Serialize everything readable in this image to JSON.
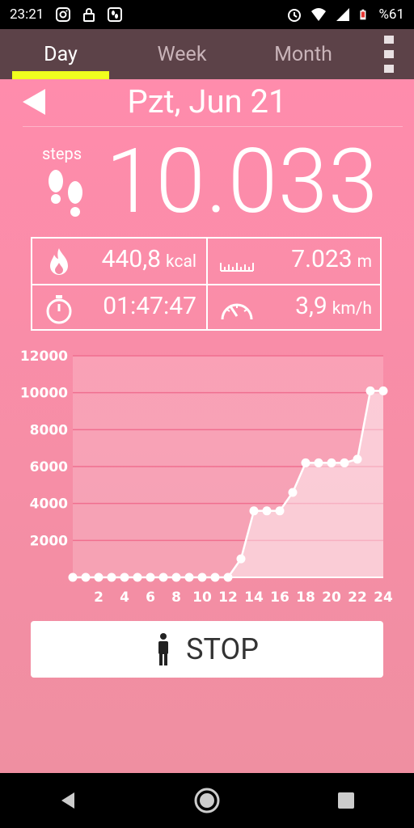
{
  "status_bar": {
    "time": "23:21",
    "battery": "%61"
  },
  "tabs": [
    {
      "label": "Day",
      "active": true
    },
    {
      "label": "Week",
      "active": false
    },
    {
      "label": "Month",
      "active": false
    }
  ],
  "date": "Pzt, Jun 21",
  "steps": {
    "label": "steps",
    "value": "10.033"
  },
  "stats": {
    "calories": {
      "value": "440,8",
      "unit": "kcal"
    },
    "distance": {
      "value": "7.023",
      "unit": "m"
    },
    "duration": {
      "value": "01:47:47",
      "unit": ""
    },
    "speed": {
      "value": "3,9",
      "unit": "km/h"
    }
  },
  "chart_data": {
    "type": "area",
    "x": [
      0,
      1,
      2,
      3,
      4,
      5,
      6,
      7,
      8,
      9,
      10,
      11,
      12,
      13,
      14,
      15,
      16,
      17,
      18,
      19,
      20,
      21,
      22,
      23,
      24
    ],
    "values": [
      0,
      0,
      0,
      0,
      0,
      0,
      0,
      0,
      0,
      0,
      0,
      0,
      0,
      1000,
      3600,
      3600,
      3600,
      4600,
      6200,
      6200,
      6200,
      6200,
      6400,
      10100,
      10100
    ],
    "x_tick_labels": [
      "2",
      "4",
      "6",
      "8",
      "10",
      "12",
      "14",
      "16",
      "18",
      "20",
      "22",
      "24"
    ],
    "y_tick_labels": [
      "2000",
      "4000",
      "6000",
      "8000",
      "10000",
      "12000"
    ],
    "ylim": [
      0,
      12000
    ],
    "xlim": [
      0,
      24
    ],
    "grid": true
  },
  "stop_button": {
    "label": "STOP"
  },
  "colors": {
    "tabbar": "#5c4248",
    "active_indicator": "#f0ff1e",
    "background": "#ff8cac"
  }
}
